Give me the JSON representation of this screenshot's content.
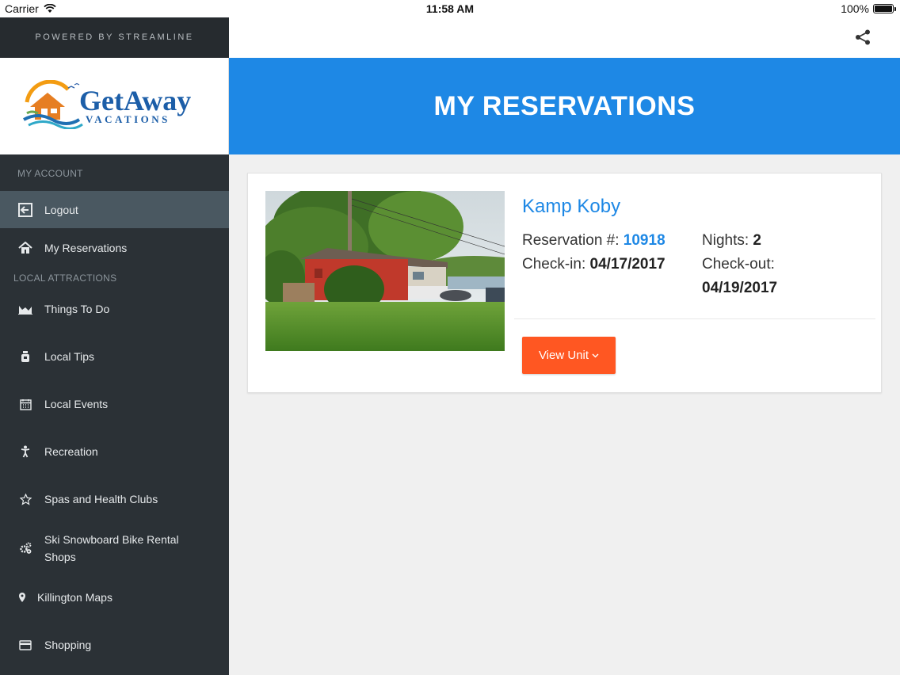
{
  "status": {
    "carrier": "Carrier",
    "time": "11:58 AM",
    "battery": "100%",
    "battery_level": 1.0
  },
  "sidebar": {
    "powered_by": "POWERED BY STREAMLINE",
    "logo": {
      "brand": "GetAway",
      "tagline": "VACATIONS"
    },
    "sections": [
      {
        "label": "MY ACCOUNT"
      },
      {
        "label": "LOCAL ATTRACTIONS"
      }
    ],
    "account_items": [
      {
        "label": "Logout",
        "icon": "logout-icon",
        "active": true
      },
      {
        "label": "My Reservations",
        "icon": "home-icon",
        "active": false
      }
    ],
    "attraction_items": [
      {
        "label": "Things To Do",
        "icon": "area-chart-icon"
      },
      {
        "label": "Local Tips",
        "icon": "tip-jar-icon"
      },
      {
        "label": "Local Events",
        "icon": "calendar-icon"
      },
      {
        "label": "Recreation",
        "icon": "person-icon"
      },
      {
        "label": "Spas and Health Clubs",
        "icon": "star-icon"
      },
      {
        "label": "Ski Snowboard Bike Rental Shops",
        "icon": "gears-icon"
      },
      {
        "label": "Killington Maps",
        "icon": "map-pin-icon"
      },
      {
        "label": "Shopping",
        "icon": "credit-card-icon"
      }
    ]
  },
  "header": {
    "title": "MY RESERVATIONS",
    "share_icon": "share-icon"
  },
  "reservation": {
    "property_name": "Kamp Koby",
    "reservation_label": "Reservation #:",
    "reservation_number": "10918",
    "nights_label": "Nights:",
    "nights": "2",
    "checkin_label": "Check-in:",
    "checkin": "04/17/2017",
    "checkout_label": "Check-out:",
    "checkout": "04/19/2017",
    "view_button": "View Unit",
    "view_button_icon": "chevron-down-icon"
  },
  "colors": {
    "accent": "#1e88e5",
    "button": "#ff5722",
    "sidebar": "#2b3136"
  }
}
